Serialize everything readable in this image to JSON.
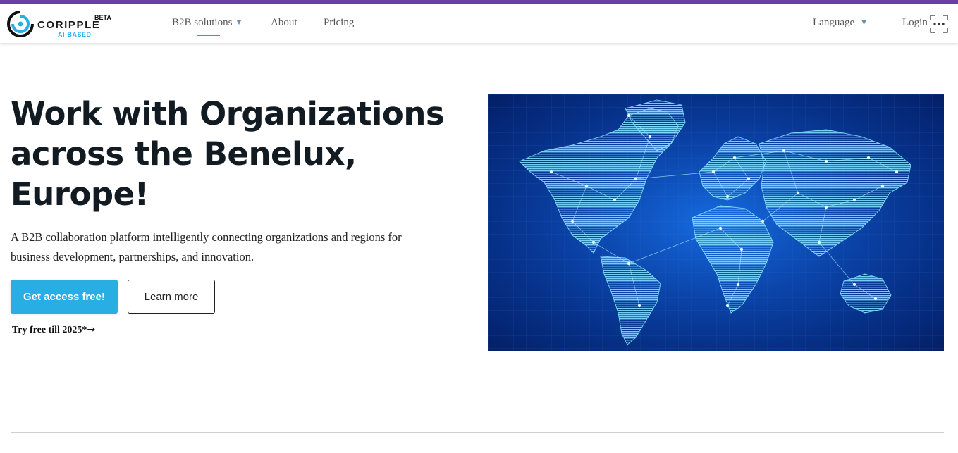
{
  "brand": {
    "name": "CORIPPLE",
    "tagline": "AI-BASED",
    "badge": "BETA",
    "colors": {
      "accent": "#29aee3",
      "top_strip": "#6a3fa6",
      "title": "#121a22"
    }
  },
  "nav": {
    "items": [
      {
        "label": "B2B solutions",
        "icon": "caret-down-icon"
      },
      {
        "label": "About"
      },
      {
        "label": "Pricing"
      }
    ],
    "language_label": "Language",
    "login_label": "Login",
    "more_icon": "more-horizontal-icon"
  },
  "hero": {
    "title": "Work with Organizations across the Benelux, Europe!",
    "description": "A B2B collaboration platform intelligently connecting organizations and regions for business development, partnerships, and innovation.",
    "primary_button": "Get access free!",
    "secondary_button": "Learn more",
    "trial_text": "Try free till 2025*",
    "trial_icon": "arrow-right-icon",
    "image": "glowing-world-map"
  }
}
